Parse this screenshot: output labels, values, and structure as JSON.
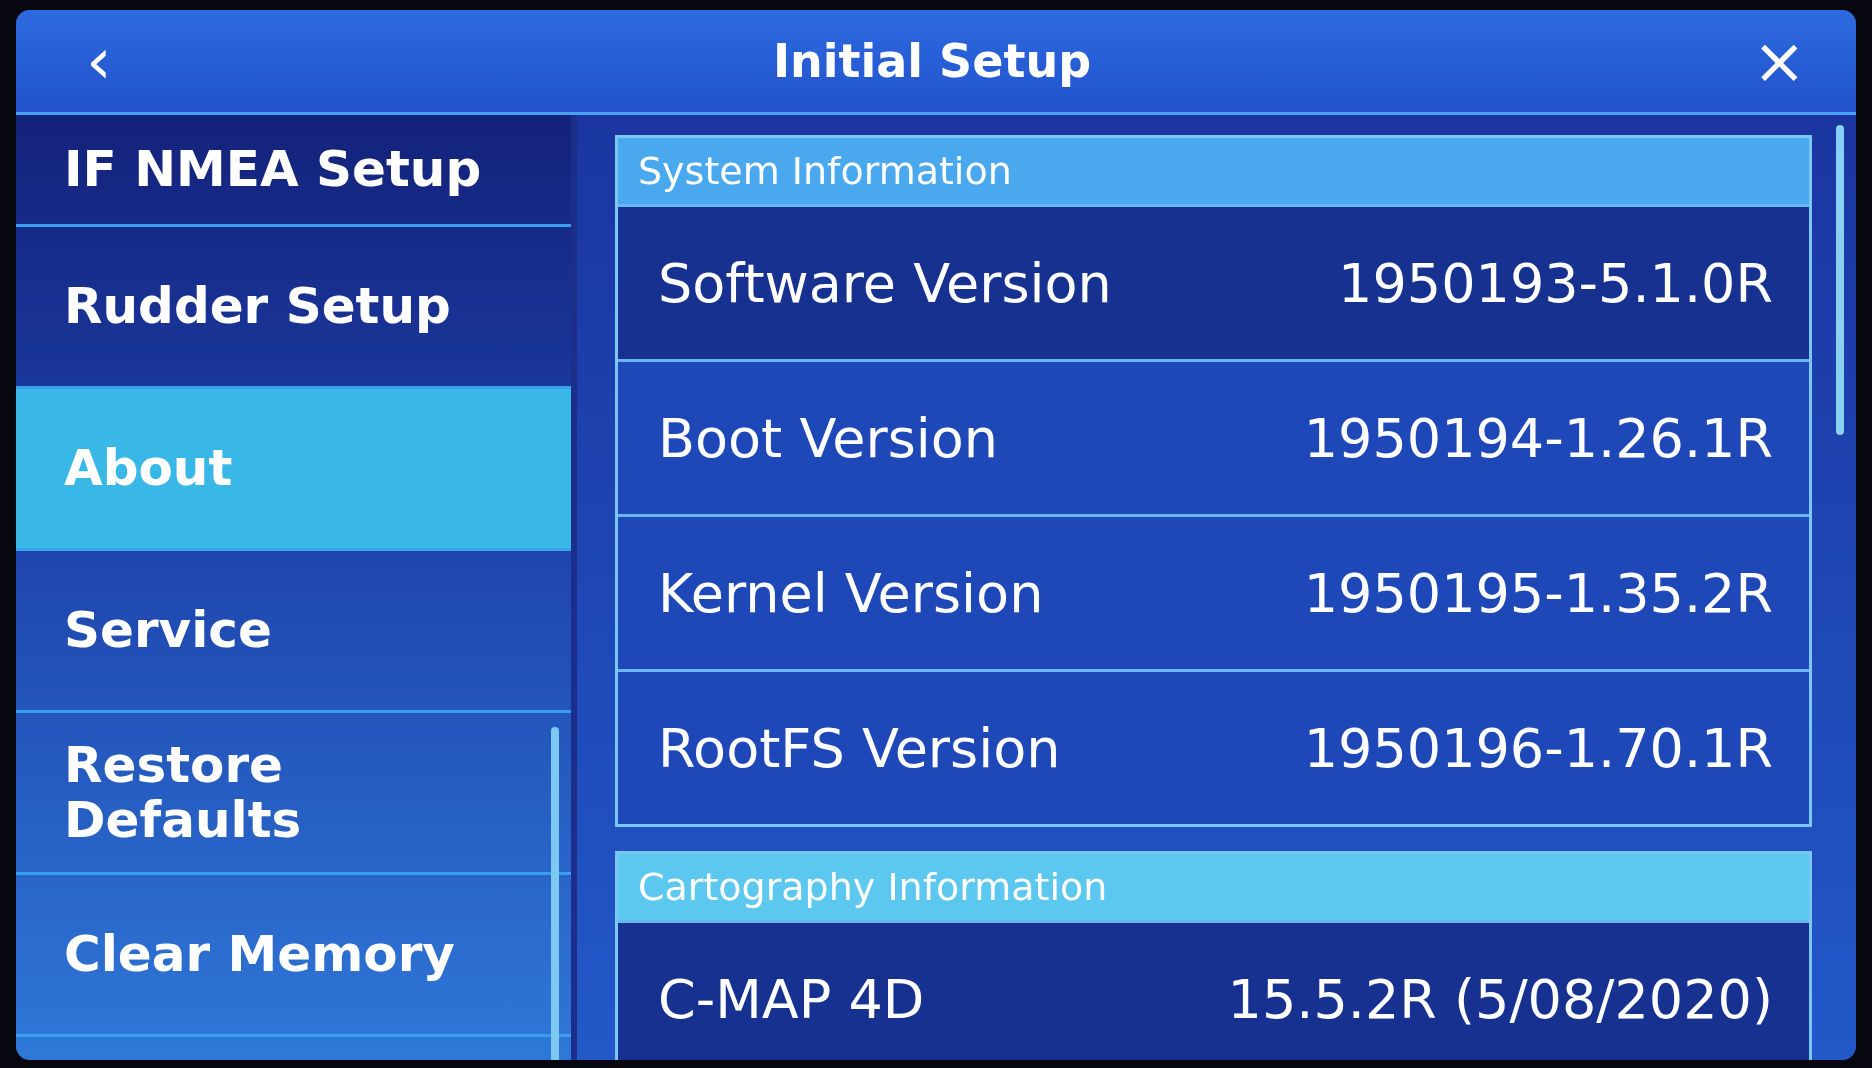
{
  "window": {
    "title": "Initial Setup",
    "back": "‹",
    "close": "×"
  },
  "sidebar": {
    "items": [
      {
        "label": "IF NMEA Setup",
        "selected": false
      },
      {
        "label": "Rudder Setup",
        "selected": false
      },
      {
        "label": "About",
        "selected": true
      },
      {
        "label": "Service",
        "selected": false
      },
      {
        "label": "Restore Defaults",
        "selected": false
      },
      {
        "label": "Clear Memory",
        "selected": false
      }
    ]
  },
  "sections": [
    {
      "title": "System Information",
      "rows": [
        {
          "label": "Software Version",
          "value": "1950193-5.1.0R"
        },
        {
          "label": "Boot Version",
          "value": "1950194-1.26.1R"
        },
        {
          "label": "Kernel Version",
          "value": "1950195-1.35.2R"
        },
        {
          "label": "RootFS Version",
          "value": "1950196-1.70.1R"
        }
      ]
    },
    {
      "title": "Cartography Information",
      "rows": [
        {
          "label": "C-MAP 4D",
          "value": "15.5.2R (5/08/2020)"
        }
      ]
    }
  ]
}
